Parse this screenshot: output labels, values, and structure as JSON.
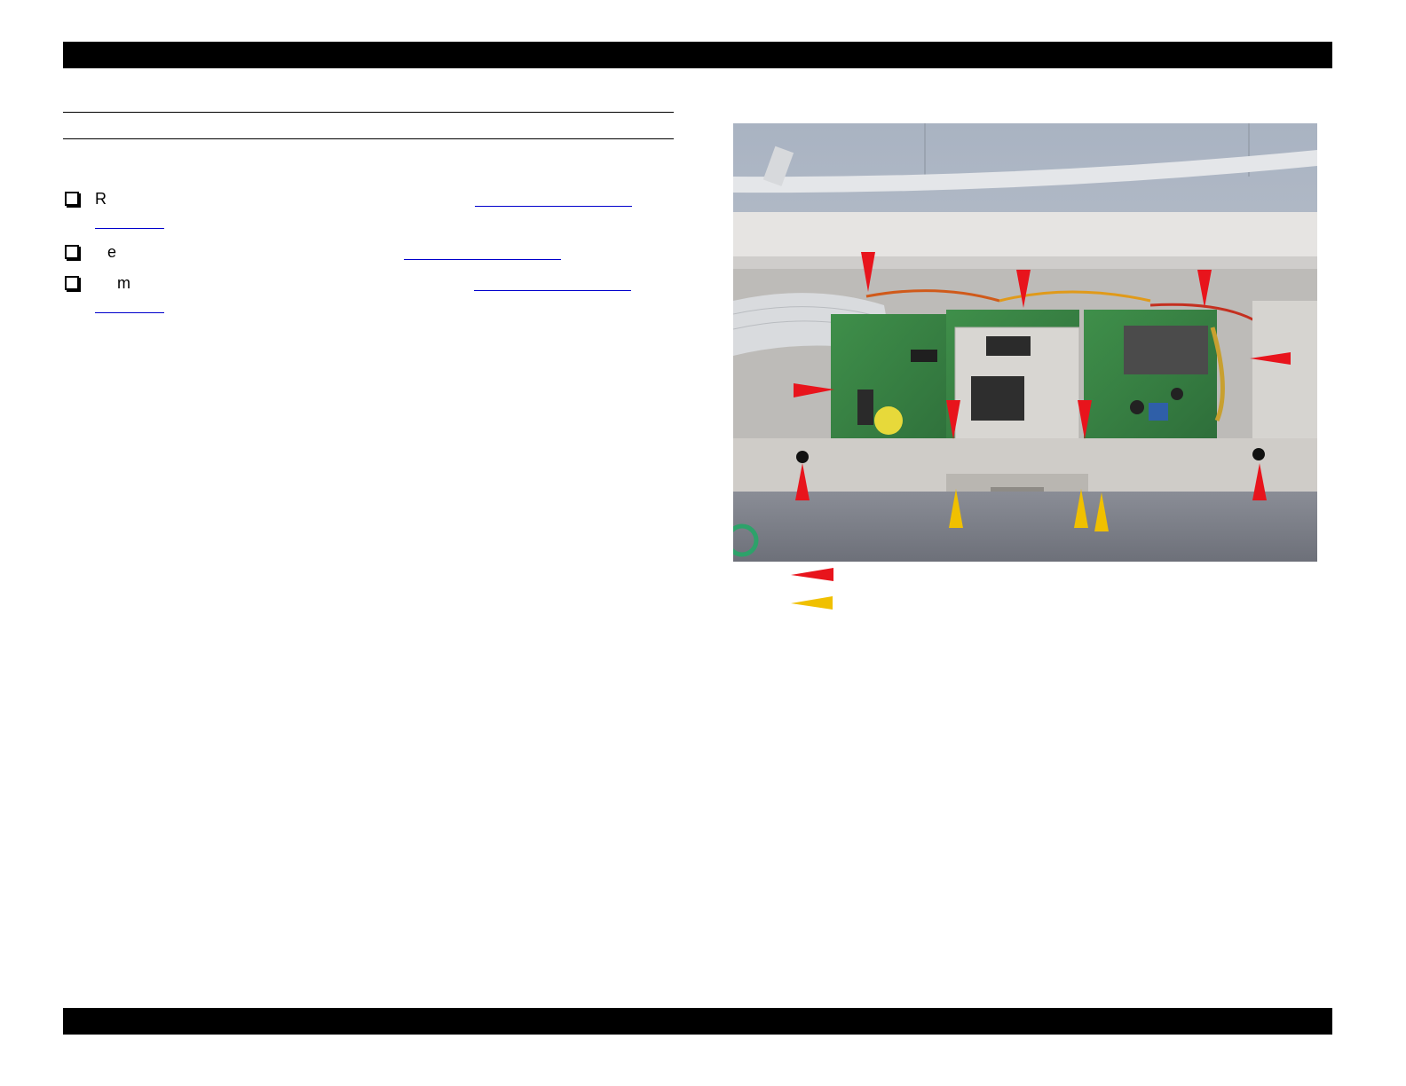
{
  "header": {
    "bar": ""
  },
  "steps": [
    {
      "lead": "R"
    },
    {
      "lead": "e"
    },
    {
      "lead": "m"
    }
  ],
  "figure": {
    "icon": "board-photo",
    "legend": [
      {
        "icon": "red-arrow-icon",
        "color": "#e8141c"
      },
      {
        "icon": "yellow-arrow-icon",
        "color": "#f0c000"
      }
    ]
  },
  "colors": {
    "link": "#0000ee",
    "arrow_red": "#e8141c",
    "arrow_yellow": "#f0c000"
  }
}
